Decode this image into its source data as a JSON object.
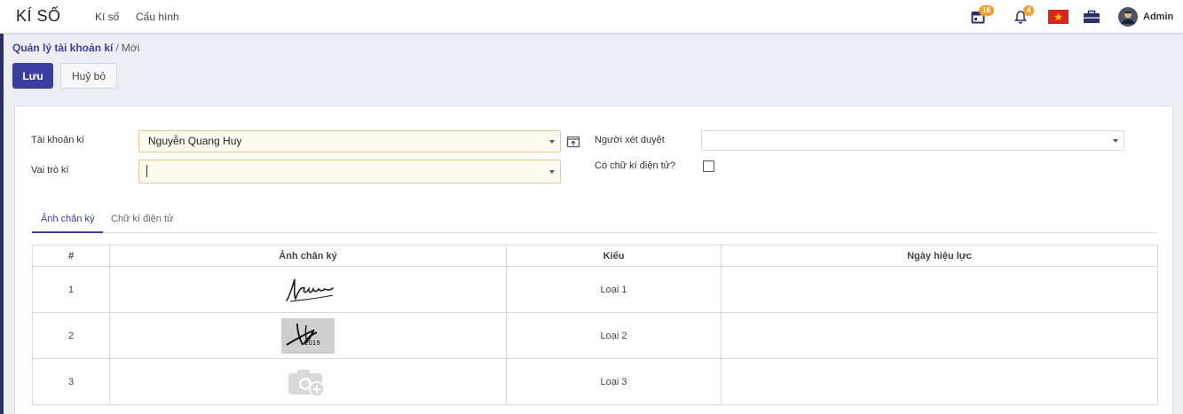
{
  "app": {
    "title": "KÍ SỐ"
  },
  "nav": {
    "menu": [
      "Kí số",
      "Cấu hình"
    ]
  },
  "systray": {
    "activity_count": "16",
    "notification_count": "4",
    "user": "Admin"
  },
  "breadcrumb": {
    "parent": "Quản lý tài khoản kí",
    "separator": "/",
    "current": "Mới"
  },
  "actions": {
    "save": "Lưu",
    "cancel": "Huỷ bỏ"
  },
  "form": {
    "signing_account_label": "Tài khoản kí",
    "signing_account_value": "Nguyễn Quang Huy",
    "signing_role_label": "Vai trò kí",
    "signing_role_value": "",
    "reviewer_label": "Người xét duyệt",
    "reviewer_value": "",
    "e_signature_label": "Có chữ kí điện tử?",
    "e_signature_checked": false
  },
  "tabs": [
    "Ảnh chân ký",
    "Chữ kí điện tử"
  ],
  "table": {
    "columns": [
      "#",
      "Ảnh chân ký",
      "Kiểu",
      "Ngày hiệu lực"
    ],
    "rows": [
      {
        "index": "1",
        "image": "signature-scribble",
        "type": "Loại 1",
        "effective_date": ""
      },
      {
        "index": "2",
        "image": "signature-stamp",
        "type": "Loại 2",
        "effective_date": ""
      },
      {
        "index": "3",
        "image": "add-photo-placeholder",
        "type": "Loại 3",
        "effective_date": ""
      }
    ]
  },
  "colors": {
    "primary": "#3a3f9f",
    "badge": "#f0a12e",
    "required_field_bg": "#fff9ef"
  }
}
